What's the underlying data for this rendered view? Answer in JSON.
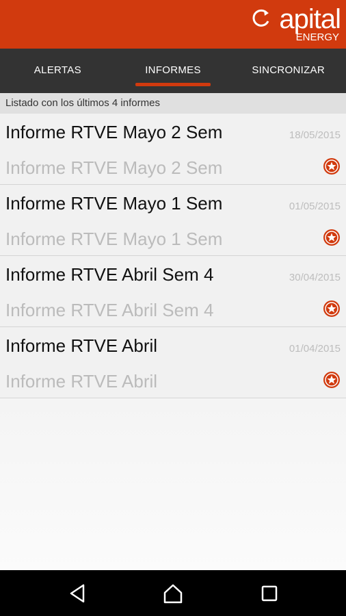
{
  "app": {
    "logo_main": "apital",
    "logo_sub": "ENERGY",
    "brand_color": "#d13a0e"
  },
  "tabs": [
    {
      "label": "ALERTAS",
      "active": false
    },
    {
      "label": "INFORMES",
      "active": true
    },
    {
      "label": "SINCRONIZAR",
      "active": false
    }
  ],
  "subheader": "Listado con los últimos 4 informes",
  "reports": [
    {
      "title": "Informe RTVE Mayo 2 Sem",
      "date": "18/05/2015",
      "subtitle": "Informe RTVE Mayo 2 Sem",
      "badge_icon": "star-badge-icon"
    },
    {
      "title": "Informe RTVE Mayo 1 Sem",
      "date": "01/05/2015",
      "subtitle": "Informe RTVE Mayo 1 Sem",
      "badge_icon": "star-badge-icon"
    },
    {
      "title": "Informe RTVE Abril Sem 4",
      "date": "30/04/2015",
      "subtitle": "Informe RTVE Abril Sem 4",
      "badge_icon": "star-badge-icon"
    },
    {
      "title": "Informe RTVE Abril",
      "date": "01/04/2015",
      "subtitle": "Informe RTVE Abril",
      "badge_icon": "star-badge-icon"
    }
  ],
  "navbar": {
    "back_icon": "back-triangle-icon",
    "home_icon": "home-icon",
    "recents_icon": "recents-square-icon"
  }
}
